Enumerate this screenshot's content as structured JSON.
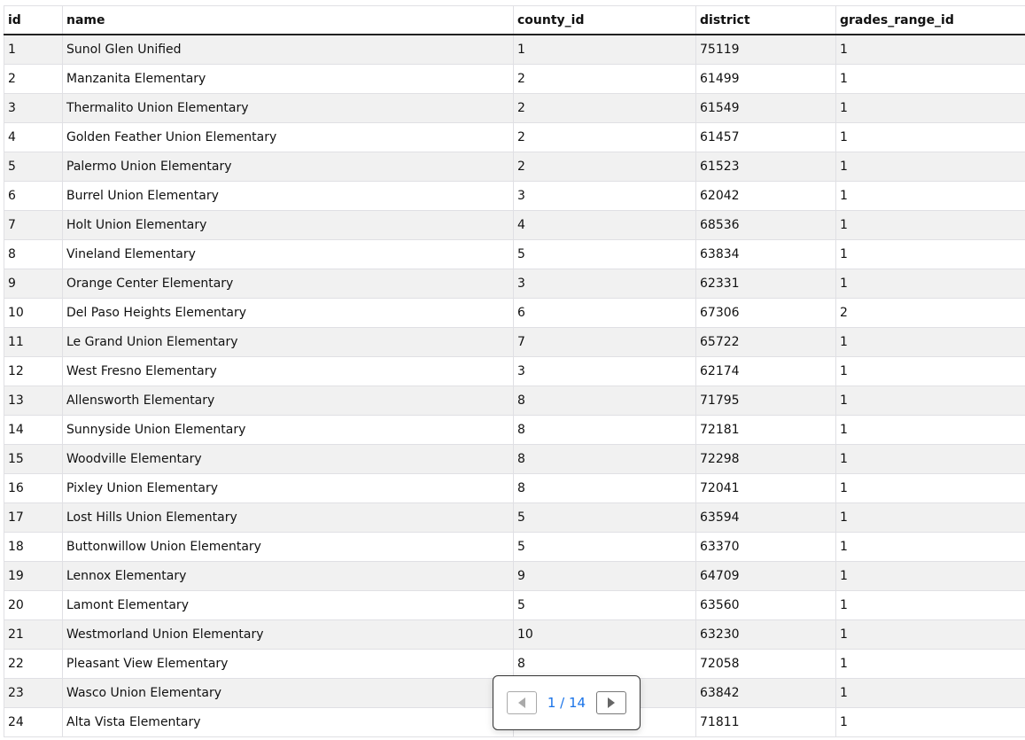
{
  "table": {
    "columns": [
      "id",
      "name",
      "county_id",
      "district",
      "grades_range_id"
    ],
    "rows": [
      [
        "1",
        "Sunol Glen Unified",
        "1",
        "75119",
        "1"
      ],
      [
        "2",
        "Manzanita Elementary",
        "2",
        "61499",
        "1"
      ],
      [
        "3",
        "Thermalito Union Elementary",
        "2",
        "61549",
        "1"
      ],
      [
        "4",
        "Golden Feather Union Elementary",
        "2",
        "61457",
        "1"
      ],
      [
        "5",
        "Palermo Union Elementary",
        "2",
        "61523",
        "1"
      ],
      [
        "6",
        "Burrel Union Elementary",
        "3",
        "62042",
        "1"
      ],
      [
        "7",
        "Holt Union Elementary",
        "4",
        "68536",
        "1"
      ],
      [
        "8",
        "Vineland Elementary",
        "5",
        "63834",
        "1"
      ],
      [
        "9",
        "Orange Center Elementary",
        "3",
        "62331",
        "1"
      ],
      [
        "10",
        "Del Paso Heights Elementary",
        "6",
        "67306",
        "2"
      ],
      [
        "11",
        "Le Grand Union Elementary",
        "7",
        "65722",
        "1"
      ],
      [
        "12",
        "West Fresno Elementary",
        "3",
        "62174",
        "1"
      ],
      [
        "13",
        "Allensworth Elementary",
        "8",
        "71795",
        "1"
      ],
      [
        "14",
        "Sunnyside Union Elementary",
        "8",
        "72181",
        "1"
      ],
      [
        "15",
        "Woodville Elementary",
        "8",
        "72298",
        "1"
      ],
      [
        "16",
        "Pixley Union Elementary",
        "8",
        "72041",
        "1"
      ],
      [
        "17",
        "Lost Hills Union Elementary",
        "5",
        "63594",
        "1"
      ],
      [
        "18",
        "Buttonwillow Union Elementary",
        "5",
        "63370",
        "1"
      ],
      [
        "19",
        "Lennox Elementary",
        "9",
        "64709",
        "1"
      ],
      [
        "20",
        "Lamont Elementary",
        "5",
        "63560",
        "1"
      ],
      [
        "21",
        "Westmorland Union Elementary",
        "10",
        "63230",
        "1"
      ],
      [
        "22",
        "Pleasant View Elementary",
        "8",
        "72058",
        "1"
      ],
      [
        "23",
        "Wasco Union Elementary",
        "",
        "63842",
        "1"
      ],
      [
        "24",
        "Alta Vista Elementary",
        "",
        "71811",
        "1"
      ]
    ]
  },
  "pagination": {
    "label": "1 / 14",
    "prev_icon": "triangle-left-icon",
    "next_icon": "triangle-right-icon",
    "accent": "#1a73e8"
  }
}
